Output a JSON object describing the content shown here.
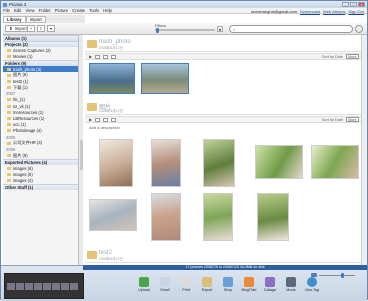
{
  "window": {
    "title": "Picasa 3"
  },
  "menu": [
    "File",
    "Edit",
    "View",
    "Folder",
    "Picture",
    "Create",
    "Tools",
    "Help"
  ],
  "account": {
    "email": "loveshanghai@gmail.com",
    "links": [
      "Screencast",
      "Web Albums",
      "Sign Out"
    ]
  },
  "tabs": {
    "library": "Library",
    "import": "Import"
  },
  "toolbar": {
    "import": "Import",
    "filters": "Filters"
  },
  "sidebar": {
    "items": [
      {
        "label": "Albums (1)",
        "kind": "cat"
      },
      {
        "label": "Projects (2)",
        "kind": "cat"
      },
      {
        "label": "Screen Captures (2)",
        "kind": "item"
      },
      {
        "label": "Movies (1)",
        "kind": "item"
      },
      {
        "label": "Folders (9)",
        "kind": "cat"
      },
      {
        "label": "trash_photo (3)",
        "kind": "item",
        "selected": true
      },
      {
        "label": "图片 (6)",
        "kind": "item"
      },
      {
        "label": "test2 (1)",
        "kind": "item"
      },
      {
        "label": "下载 (1)",
        "kind": "item"
      },
      {
        "label": "2007",
        "kind": "year"
      },
      {
        "label": "hk_(1)",
        "kind": "item"
      },
      {
        "label": "sz_vk (1)",
        "kind": "item"
      },
      {
        "label": "Innresources (1)",
        "kind": "item"
      },
      {
        "label": "LBResources (1)",
        "kind": "item"
      },
      {
        "label": "ucc (1)",
        "kind": "item"
      },
      {
        "label": "Photoimage (4)",
        "kind": "item"
      },
      {
        "label": "2006",
        "kind": "year"
      },
      {
        "label": "公司文件HR (4)",
        "kind": "item"
      },
      {
        "label": "2005",
        "kind": "year"
      },
      {
        "label": "图片 (9)",
        "kind": "item"
      },
      {
        "label": "Exported Pictures (4)",
        "kind": "cat"
      },
      {
        "label": "images (6)",
        "kind": "item"
      },
      {
        "label": "images (6)",
        "kind": "item"
      },
      {
        "label": "images (4)",
        "kind": "item"
      },
      {
        "label": "Other Stuff (1)",
        "kind": "cat"
      }
    ]
  },
  "albums": [
    {
      "name": "trash_photo",
      "date": "2008年8月12日",
      "sort": "Sort by Date",
      "more": "More"
    },
    {
      "name": "图片",
      "date": "2008年8月12日",
      "sort": "Sort by Date",
      "more": "More",
      "description": "Add a description"
    },
    {
      "name": "test2",
      "date": "2008年8月12日"
    }
  ],
  "status": "17 pictures   2008/7/5 to 2008/7/20   34.4MB on disk",
  "actions": [
    "Upload",
    "Email",
    "Print",
    "Export",
    "Shop",
    "BlogThis!",
    "Collage",
    "Movie",
    "Geo-Tag"
  ],
  "colors": {
    "accent": "#3d7cc9",
    "selected": "#3d7cc9",
    "folder": "#e3c476"
  }
}
